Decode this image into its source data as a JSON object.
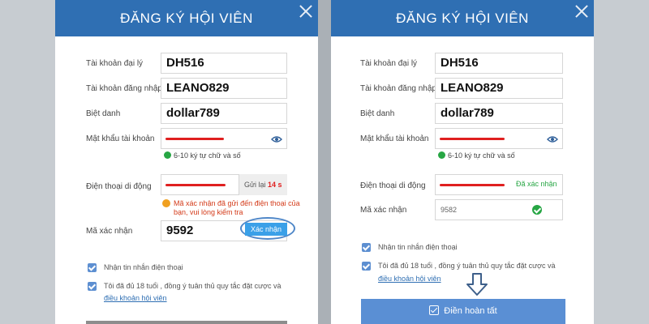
{
  "left": {
    "title": "ĐĂNG KÝ HỘI VIÊN",
    "labels": {
      "agent": "Tài khoản đại lý",
      "login": "Tài khoản đăng nhập",
      "nickname": "Biệt danh",
      "password": "Mật khẩu tài khoản",
      "phone": "Điện thoại di động",
      "code": "Mã xác nhận"
    },
    "values": {
      "agent": "DH516",
      "login": "LEANO829",
      "nickname": "dollar789",
      "code": "9592"
    },
    "password_hint": "6-10 ký tự chữ và số",
    "resend_label": "Gửi lại",
    "resend_count": "14 s",
    "warning_line1": "Mã xác nhận đã gửi đến điện thoại của",
    "warning_line2": "bạn, vui lòng kiểm tra",
    "confirm_button": "Xác nhận",
    "sms_label": "Nhận tin nhắn điện thoại",
    "age_label": "Tôi đã đủ 18 tuổi , đồng ý tuân thủ quy tắc đặt cược và",
    "terms_link": "điều khoản hội viên"
  },
  "right": {
    "title": "ĐĂNG KÝ HỘI VIÊN",
    "labels": {
      "agent": "Tài khoản đại lý",
      "login": "Tài khoản đăng nhập",
      "nickname": "Biệt danh",
      "password": "Mật khẩu tài khoản",
      "phone": "Điện thoại di động",
      "code": "Mã xác nhận"
    },
    "values": {
      "agent": "DH516",
      "login": "LEANO829",
      "nickname": "dollar789",
      "code": "9582"
    },
    "password_hint": "6-10 ký tự chữ và số",
    "verified_label": "Đã xác nhận",
    "sms_label": "Nhận tin nhắn điện thoại",
    "age_label": "Tôi đã đủ 18 tuổi , đồng ý tuân thủ quy tắc đặt cược và",
    "terms_link": "điều khoản hội viên",
    "done_button": "Điền hoàn tất"
  },
  "colors": {
    "header": "#2f6fb3",
    "accent_red": "#e02020",
    "ok_green": "#27a644",
    "button_blue": "#5a8fd4"
  },
  "icons": [
    "close-icon",
    "eye-icon",
    "check-circle-icon",
    "warning-icon",
    "checkbox-icon",
    "down-arrow-icon"
  ]
}
